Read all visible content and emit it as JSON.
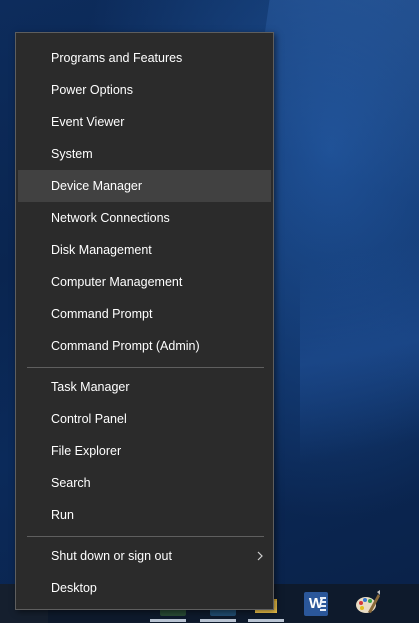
{
  "menu": {
    "group1": [
      {
        "label": "Programs and Features"
      },
      {
        "label": "Power Options"
      },
      {
        "label": "Event Viewer"
      },
      {
        "label": "System"
      },
      {
        "label": "Device Manager"
      },
      {
        "label": "Network Connections"
      },
      {
        "label": "Disk Management"
      },
      {
        "label": "Computer Management"
      },
      {
        "label": "Command Prompt"
      },
      {
        "label": "Command Prompt (Admin)"
      }
    ],
    "group2": [
      {
        "label": "Task Manager"
      },
      {
        "label": "Control Panel"
      },
      {
        "label": "File Explorer"
      },
      {
        "label": "Search"
      },
      {
        "label": "Run"
      }
    ],
    "group3": [
      {
        "label": "Shut down or sign out",
        "icon": "chevron-right-icon"
      },
      {
        "label": "Desktop"
      }
    ],
    "highlighted_item": "Device Manager"
  },
  "taskbar": {
    "icons": [
      "file-explorer-icon",
      "word-icon",
      "paint-icon"
    ],
    "word_icon_letter": "W"
  },
  "colors": {
    "menu_background": "#2b2b2b",
    "menu_hover": "#414141",
    "menu_text": "#ffffff",
    "desktop_blue": "#0d2c5c",
    "word_blue": "#2b579a"
  }
}
